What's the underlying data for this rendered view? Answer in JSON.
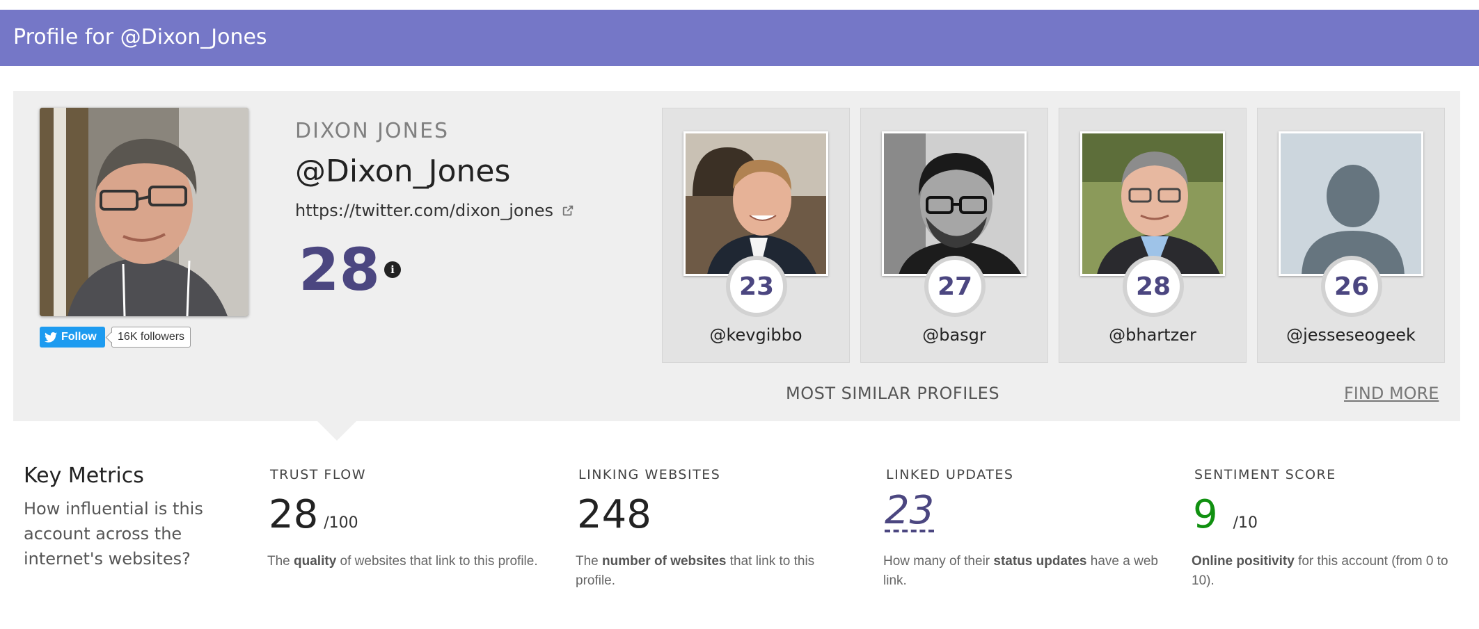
{
  "header": {
    "title": "Profile for @Dixon_Jones"
  },
  "profile": {
    "display_name": "DIXON JONES",
    "handle": "@Dixon_Jones",
    "url": "https://twitter.com/dixon_jones",
    "score": "28",
    "follow_label": "Follow",
    "followers": "16K followers"
  },
  "similar": {
    "label": "MOST SIMILAR PROFILES",
    "find_more": "FIND MORE",
    "profiles": [
      {
        "handle": "@kevgibbo",
        "score": "23"
      },
      {
        "handle": "@basgr",
        "score": "27"
      },
      {
        "handle": "@bhartzer",
        "score": "28"
      },
      {
        "handle": "@jesseseogeek",
        "score": "26"
      }
    ]
  },
  "key_metrics": {
    "title": "Key Metrics",
    "subtitle": "How influential is this account across the internet's websites?",
    "items": [
      {
        "label": "TRUST FLOW",
        "value": "28",
        "unit": "/100",
        "desc_pre": "The ",
        "desc_bold": "quality",
        "desc_post": " of websites that link to this profile."
      },
      {
        "label": "LINKING WEBSITES",
        "value": "248",
        "unit": "",
        "desc_pre": "The ",
        "desc_bold": "number of websites",
        "desc_post": " that link to this profile."
      },
      {
        "label": "LINKED UPDATES",
        "value": "23",
        "unit": "",
        "desc_pre": "How many of their ",
        "desc_bold": "status updates",
        "desc_post": " have a web link."
      },
      {
        "label": "SENTIMENT SCORE",
        "value": "9",
        "unit": "/10",
        "desc_pre": "",
        "desc_bold": "Online positivity",
        "desc_post": " for this account (from 0 to 10)."
      }
    ]
  },
  "colors": {
    "header_bg": "#7577c7",
    "score": "#4b4680",
    "sentiment": "#109010",
    "twitter": "#1d9bf0"
  }
}
